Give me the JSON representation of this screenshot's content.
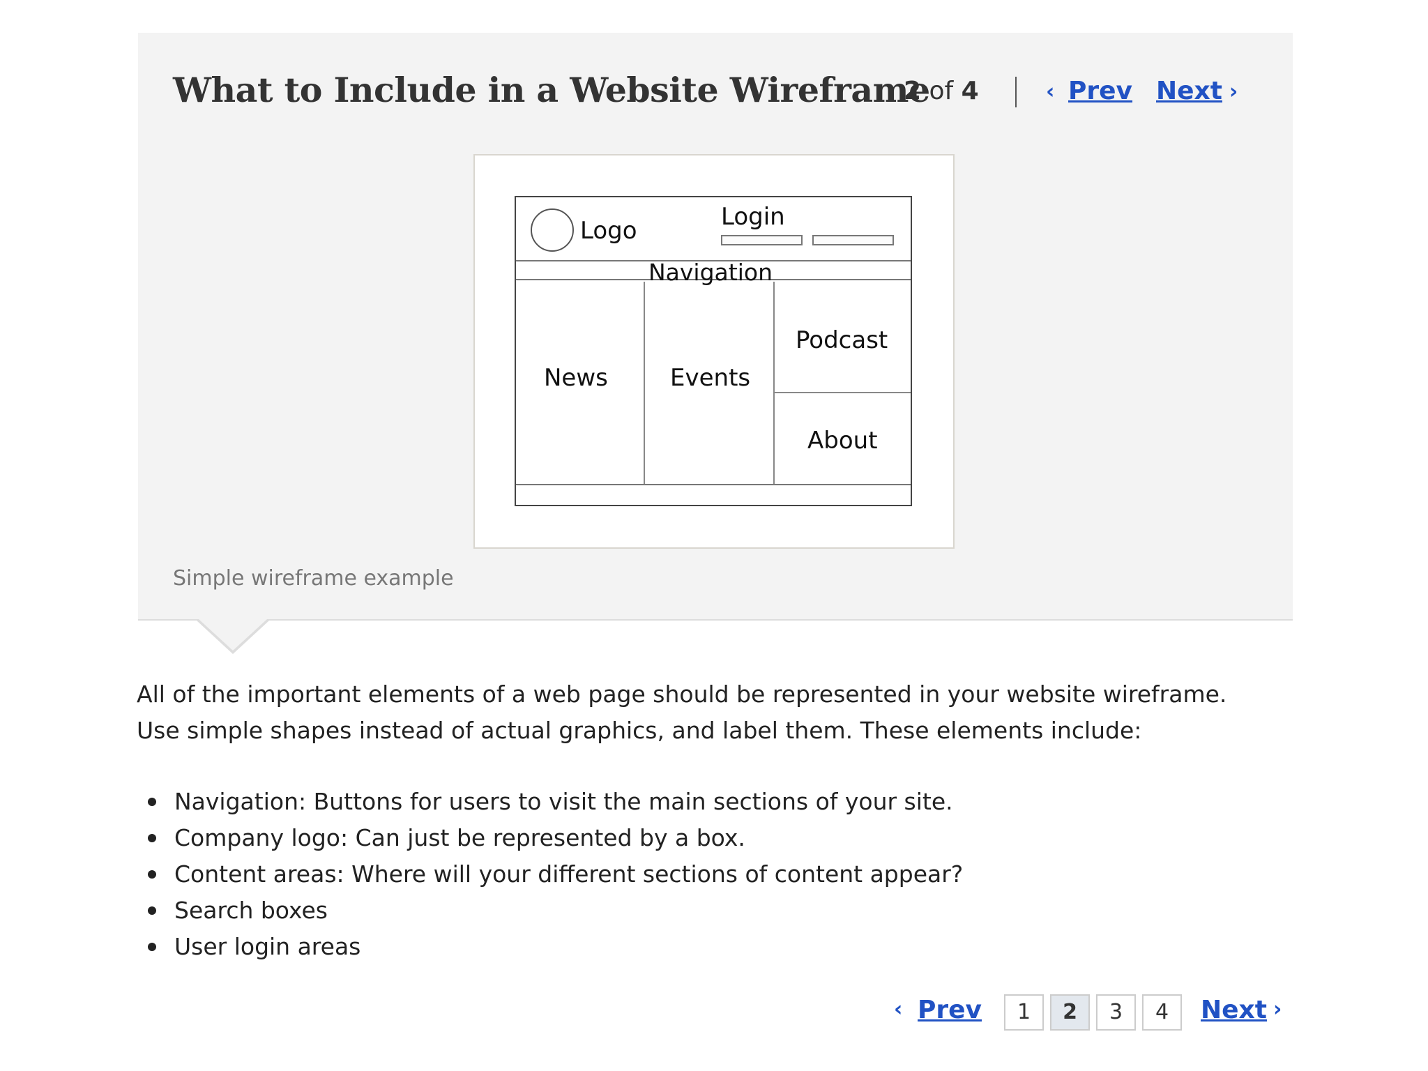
{
  "header": {
    "title": "What to Include in a Website Wireframe",
    "counter": {
      "current": "2",
      "of": "of",
      "total": "4"
    },
    "prev_label": "Prev",
    "next_label": "Next"
  },
  "figure": {
    "wireframe": {
      "logo": "Logo",
      "login": "Login",
      "navigation": "Navigation",
      "news": "News",
      "events": "Events",
      "podcast": "Podcast",
      "about": "About"
    },
    "caption": "Simple wireframe example"
  },
  "body": {
    "line1": "All of the important elements of a web page should be represented in your website wireframe.",
    "line2": "Use simple shapes instead of actual graphics, and label them. These elements include:",
    "bullets": [
      "Navigation: Buttons for users to visit the main sections of your site.",
      "Company logo: Can just be represented by a box.",
      "Content areas: Where will your different sections of content appear?",
      "Search boxes",
      "User login areas"
    ]
  },
  "pagination": {
    "prev_label": "Prev",
    "next_label": "Next",
    "pages": [
      "1",
      "2",
      "3",
      "4"
    ],
    "current_page": "2"
  },
  "colors": {
    "link": "#2152c4",
    "panel_bg": "#f3f3f3",
    "current_page_bg": "#e3e8ee"
  },
  "icons": {
    "prev": "chevron-left-icon",
    "next": "chevron-right-icon",
    "bullet": "bullet-dot-icon"
  }
}
